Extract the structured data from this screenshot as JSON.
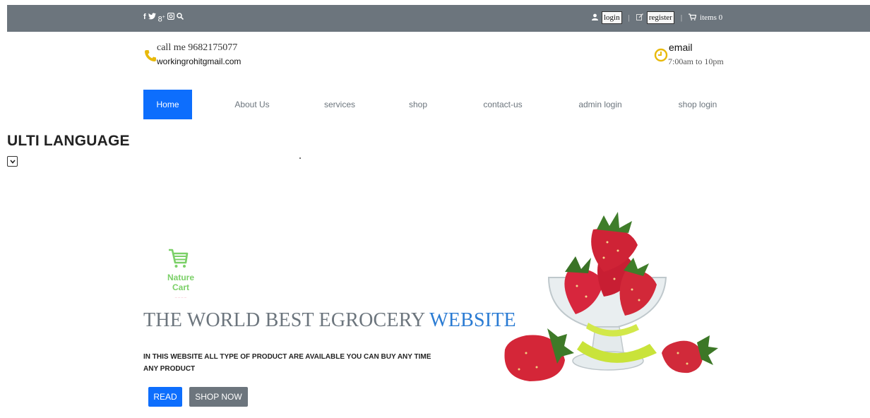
{
  "topbar": {
    "social_icons": [
      {
        "name": "facebook-icon",
        "glyph": "f"
      },
      {
        "name": "twitter-icon",
        "glyph": "🐦"
      },
      {
        "name": "google-plus-icon",
        "glyph": "8⁺"
      },
      {
        "name": "instagram-icon",
        "glyph": "◙"
      },
      {
        "name": "search-icon",
        "glyph": "🔍"
      }
    ],
    "login_label": "login",
    "register_label": "register",
    "cart_label": "items 0",
    "separator": "|"
  },
  "contact": {
    "call": "call me 9682175077",
    "mail": "workingrohitgmail.com",
    "email_label": "email",
    "hours": "7:00am to 10pm"
  },
  "nav": {
    "items": [
      {
        "label": "Home",
        "active": true
      },
      {
        "label": "About Us"
      },
      {
        "label": "services"
      },
      {
        "label": "shop"
      },
      {
        "label": "contact-us"
      },
      {
        "label": "admin login"
      },
      {
        "label": "shop login"
      }
    ]
  },
  "language": {
    "title": "ULTI LANGUAGE"
  },
  "hero": {
    "logo_line1": "Nature",
    "logo_line2": "Cart",
    "title_main": "THE WORLD BEST EGROCERY",
    "title_highlight": "WEBSITE",
    "description": "IN THIS WEBSITE ALL TYPE OF PRODUCT ARE AVAILABLE YOU CAN BUY ANY TIME ANY PRODUCT",
    "read_label": "READ",
    "shop_label": "SHOP NOW"
  },
  "colors": {
    "topbar": "#6c757d",
    "primary": "#0d6efd",
    "accent_icon": "#e8b90b",
    "logo_green": "#7bd068",
    "title_highlight": "#2a7bd3"
  }
}
